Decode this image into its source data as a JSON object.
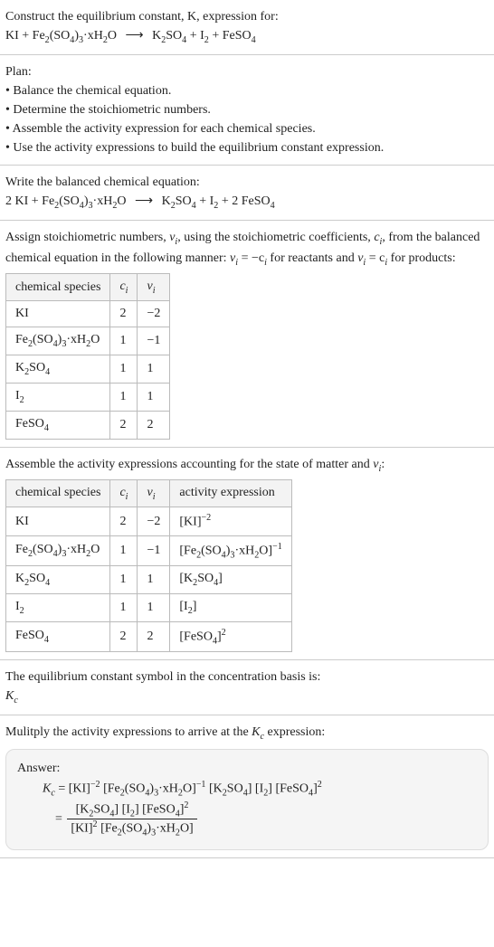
{
  "s1": {
    "title": "Construct the equilibrium constant, K, expression for:",
    "eq_lhs1": "KI + Fe",
    "eq_lhs2": "(SO",
    "eq_lhs3": ")",
    "eq_lhs4": "·xH",
    "eq_lhs5": "O",
    "arrow": "⟶",
    "rhs1": "K",
    "rhs2": "SO",
    "rhs3": " + I",
    "rhs4": " + FeSO"
  },
  "s2": {
    "title": "Plan:",
    "b1": "• Balance the chemical equation.",
    "b2": "• Determine the stoichiometric numbers.",
    "b3": "• Assemble the activity expression for each chemical species.",
    "b4": "• Use the activity expressions to build the equilibrium constant expression."
  },
  "s3": {
    "title": "Write the balanced chemical equation:",
    "pre": "2 KI + Fe",
    "mid1": "(SO",
    "mid2": ")",
    "mid3": "·xH",
    "mid4": "O",
    "arrow": "⟶",
    "r1": "K",
    "r2": "SO",
    "r3": " + I",
    "r4": " + 2 FeSO"
  },
  "s4": {
    "intro1": "Assign stoichiometric numbers, ",
    "nu_i": "ν",
    "intro2": ", using the stoichiometric coefficients, ",
    "c_i": "c",
    "intro3": ", from the balanced chemical equation in the following manner: ",
    "rel1a": "ν",
    "rel1b": " = −c",
    "rel1c": " for reactants and ",
    "rel2a": "ν",
    "rel2b": " = c",
    "rel2c": " for products:",
    "h1": "chemical species",
    "h2": "c",
    "h3": "ν",
    "rows": [
      {
        "sp_a": "KI",
        "sp_b": "",
        "sp_c": "",
        "sp_d": "",
        "sp_e": "",
        "sp_f": "",
        "sp_g": "",
        "c": "2",
        "v": "−2"
      },
      {
        "sp_a": "Fe",
        "sp_b": "(SO",
        "sp_c": ")",
        "sp_d": "·xH",
        "sp_e": "O",
        "sp_f": "",
        "sp_g": "",
        "c": "1",
        "v": "−1"
      },
      {
        "sp_a": "K",
        "sp_b": "SO",
        "sp_c": "",
        "sp_d": "",
        "sp_e": "",
        "sp_f": "",
        "sp_g": "",
        "c": "1",
        "v": "1"
      },
      {
        "sp_a": "I",
        "sp_b": "",
        "sp_c": "",
        "sp_d": "",
        "sp_e": "",
        "sp_f": "",
        "sp_g": "",
        "c": "1",
        "v": "1"
      },
      {
        "sp_a": "FeSO",
        "sp_b": "",
        "sp_c": "",
        "sp_d": "",
        "sp_e": "",
        "sp_f": "",
        "sp_g": "",
        "c": "2",
        "v": "2"
      }
    ]
  },
  "s5": {
    "title": "Assemble the activity expressions accounting for the state of matter and ",
    "nu": "ν",
    "colon": ":",
    "h1": "chemical species",
    "h2": "c",
    "h3": "ν",
    "h4": "activity expression",
    "rows": [
      {
        "c": "2",
        "v": "−2"
      },
      {
        "c": "1",
        "v": "−1"
      },
      {
        "c": "1",
        "v": "1"
      },
      {
        "c": "1",
        "v": "1"
      },
      {
        "c": "2",
        "v": "2"
      }
    ],
    "sp0": "KI",
    "sp1a": "Fe",
    "sp1b": "(SO",
    "sp1c": ")",
    "sp1d": "·xH",
    "sp1e": "O",
    "sp2a": "K",
    "sp2b": "SO",
    "sp3a": "I",
    "sp4a": "FeSO",
    "ae0a": "[KI]",
    "ae0exp": "−2",
    "ae1a": "[Fe",
    "ae1b": "(SO",
    "ae1c": ")",
    "ae1d": "·xH",
    "ae1e": "O]",
    "ae1exp": "−1",
    "ae2a": "[K",
    "ae2b": "SO",
    "ae2c": "]",
    "ae3a": "[I",
    "ae3b": "]",
    "ae4a": "[FeSO",
    "ae4b": "]",
    "ae4exp": "2"
  },
  "s6": {
    "l1": "The equilibrium constant symbol in the concentration basis is:",
    "sym": "K",
    "sub": "c"
  },
  "s7": {
    "l1": "Mulitply the activity expressions to arrive at the ",
    "Kc": "K",
    "Kc_sub": "c",
    "l2": " expression:"
  },
  "ans": {
    "title": "Answer:",
    "Kc": "K",
    "Kc_sub": "c",
    "eq": " = ",
    "t1": "[KI]",
    "t1e": "−2",
    "t2a": "[Fe",
    "t2b": "(SO",
    "t2c": ")",
    "t2d": "·xH",
    "t2e": "O]",
    "t2exp": "−1",
    "t3a": "[K",
    "t3b": "SO",
    "t3c": "]",
    "t4a": "[I",
    "t4b": "]",
    "t5a": "[FeSO",
    "t5b": "]",
    "t5e": "2",
    "num1a": "[K",
    "num1b": "SO",
    "num1c": "] ",
    "num2a": "[I",
    "num2b": "] ",
    "num3a": "[FeSO",
    "num3b": "]",
    "num3e": "2",
    "den1a": "[KI]",
    "den1e": "2",
    "den2a": "[Fe",
    "den2b": "(SO",
    "den2c": ")",
    "den2d": "·xH",
    "den2e": "O]",
    "eq2": " = "
  },
  "chart_data": {
    "type": "table",
    "title": "Stoichiometric numbers",
    "columns": [
      "chemical species",
      "c_i",
      "ν_i"
    ],
    "rows": [
      [
        "KI",
        2,
        -2
      ],
      [
        "Fe2(SO4)3·xH2O",
        1,
        -1
      ],
      [
        "K2SO4",
        1,
        1
      ],
      [
        "I2",
        1,
        1
      ],
      [
        "FeSO4",
        2,
        2
      ]
    ]
  }
}
